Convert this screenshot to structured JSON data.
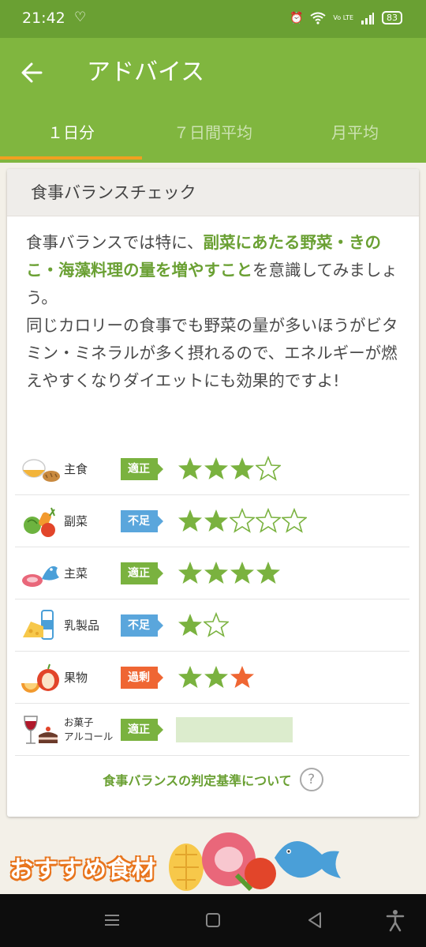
{
  "status_bar": {
    "time": "21:42",
    "battery": "83",
    "network": "Vo LTE"
  },
  "app_bar": {
    "title": "アドバイス"
  },
  "tabs": [
    {
      "label": "１日分",
      "active": true
    },
    {
      "label": "７日間平均",
      "active": false
    },
    {
      "label": "月平均",
      "active": false
    }
  ],
  "card": {
    "header": "食事バランスチェック",
    "advice_1": "食事バランスでは特に、",
    "advice_highlight": "副菜にあたる野菜・きのこ・海藻料理の量を増やすこと",
    "advice_2": "を意識してみましょう。",
    "advice_3": "同じカロリーの食事でも野菜の量が多いほうがビタミン・ミネラルが多く摂れるので、エネルギーが燃えやすくなりダイエットにも効果的ですよ!",
    "rows": [
      {
        "label": "主食",
        "status": "適正",
        "filled": 3,
        "total": 4,
        "icon": "rice-bread-icon"
      },
      {
        "label": "副菜",
        "status": "不足",
        "filled": 2,
        "total": 5,
        "icon": "vegetables-icon"
      },
      {
        "label": "主菜",
        "status": "適正",
        "filled": 4,
        "total": 4,
        "icon": "meat-fish-icon"
      },
      {
        "label": "乳製品",
        "status": "不足",
        "filled": 1,
        "total": 2,
        "icon": "dairy-icon"
      },
      {
        "label": "果物",
        "status": "過剰",
        "filled": 2,
        "over": 1,
        "total": 3,
        "icon": "fruit-icon"
      },
      {
        "label_line1": "お菓子",
        "label_line2": "アルコール",
        "status": "適正",
        "icon": "sweets-alcohol-icon"
      }
    ],
    "criteria_link": "食事バランスの判定基準について",
    "help_symbol": "?"
  },
  "recommended": {
    "title": "おすすめ食材"
  },
  "colors": {
    "green": "#80b63f",
    "dark_green": "#6aa033",
    "ok": "#7ab23f",
    "low": "#5aa6dc",
    "over": "#ef6633",
    "star": "#7ab23f",
    "orange_tab": "#f0a020"
  }
}
